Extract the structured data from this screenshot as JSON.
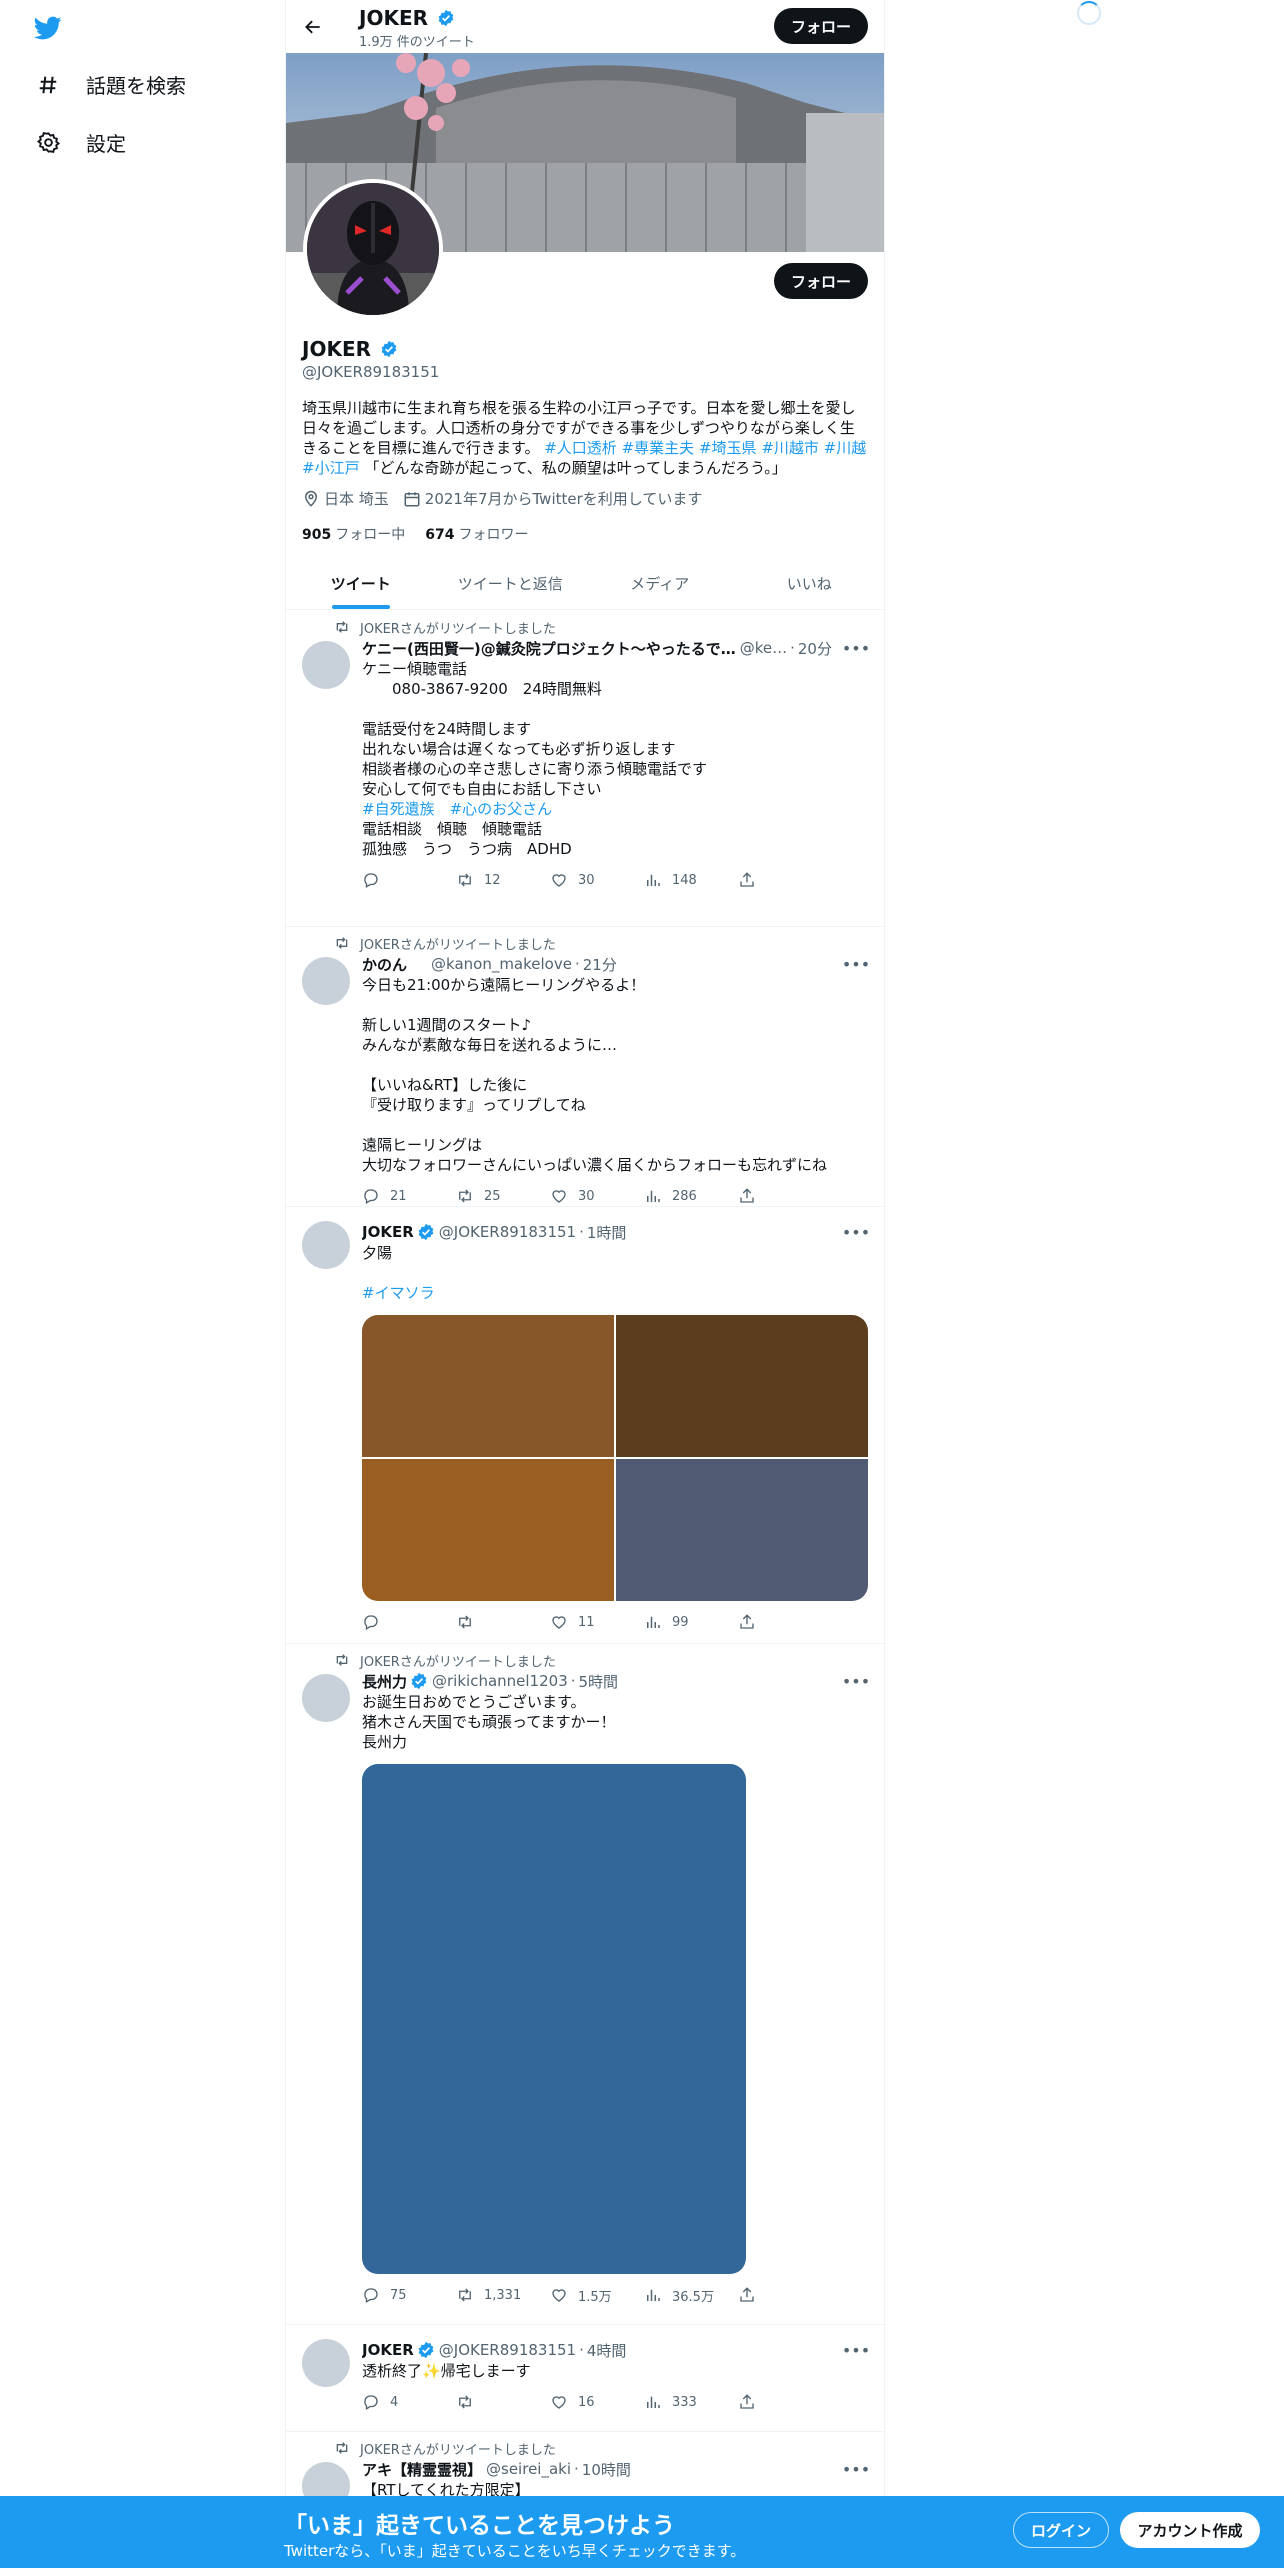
{
  "colors": {
    "accent": "#1d9bf0",
    "dark": "#0f1419",
    "muted": "#536471"
  },
  "sidebar": {
    "items": [
      {
        "icon": "hashtag-icon",
        "label": "話題を検索"
      },
      {
        "icon": "gear-icon",
        "label": "設定"
      }
    ]
  },
  "header": {
    "name": "JOKER",
    "tweet_count": "1.9万 件のツイート",
    "follow_label": "フォロー"
  },
  "profile": {
    "name": "JOKER",
    "handle": "@JOKER89183151",
    "follow_label": "フォロー",
    "bio_text": "埼玉県川越市に生まれ育ち根を張る生粋の小江戸っ子です。日本を愛し郷土を愛し日々を過ごします。人口透析の身分ですができる事を少しずつやりながら楽しく生きることを目標に進んで行きます。",
    "bio_tags": [
      "#人口透析",
      "#専業主夫",
      "#埼玉県",
      "#川越市",
      "#川越",
      "#小江戸"
    ],
    "bio_tail": "「どんな奇跡が起こって、私の願望は叶ってしまうんだろう。」",
    "location": "日本 埼玉",
    "joined": "2021年7月からTwitterを利用しています",
    "following_count": "905",
    "following_label": "フォロー中",
    "followers_count": "674",
    "followers_label": "フォロワー"
  },
  "tabs": [
    {
      "label": "ツイート",
      "active": true
    },
    {
      "label": "ツイートと返信",
      "active": false
    },
    {
      "label": "メディア",
      "active": false
    },
    {
      "label": "いいね",
      "active": false
    }
  ],
  "tweets": [
    {
      "retweeted_by": "JOKERさんがリツイートしました",
      "name": "ケニー(西田賢一)@鍼灸院プロジェクト～やったるで…",
      "handle": "@ke…",
      "time": "20分",
      "body": "ケニー傾聴電話\n　　080-3867-9200　24時間無料\n\n電話受付を24時間します\n出れない場合は遅くなっても必ず折り返します\n相談者様の心の辛さ悲しさに寄り添う傾聴電話です\n安心して何でも自由にお話し下さい\n",
      "tags": "#自死遺族　#心のお父さん",
      "body2": "電話相談　傾聴　傾聴電話\n孤独感　うつ　うつ病　ADHD",
      "replies": "",
      "retweets": "12",
      "likes": "30",
      "views": "148"
    },
    {
      "retweeted_by": "JOKERさんがリツイートしました",
      "name": "かのん",
      "handle": "@kanon_makelove",
      "time": "21分",
      "body": "今日も21:00から遠隔ヒーリングやるよ！\n\n新しい1週間のスタート♪\nみんなが素敵な毎日を送れるように…\n\n【いいね&RT】した後に\n『受け取ります』ってリプしてね\n\n遠隔ヒーリングは\n大切なフォロワーさんにいっぱい濃く届くからフォローも忘れずにね",
      "replies": "21",
      "retweets": "25",
      "likes": "30",
      "views": "286"
    },
    {
      "name": "JOKER",
      "handle": "@JOKER89183151",
      "time": "1時間",
      "body": "夕陽\n",
      "tags": "#イマソラ",
      "media_colors": [
        "#87572a",
        "#5c3d1e",
        "#9a5e22",
        "#505a72"
      ],
      "replies": "",
      "retweets": "",
      "likes": "11",
      "views": "99"
    },
    {
      "retweeted_by": "JOKERさんがリツイートしました",
      "name": "長州力",
      "handle": "@rikichannel1203",
      "time": "5時間",
      "body": "お誕生日おめでとうございます。\n猪木さん天国でも頑張ってますかー！\n長州力",
      "media_color": "#336699",
      "replies": "75",
      "retweets": "1,331",
      "likes": "1.5万",
      "views": "36.5万"
    },
    {
      "name": "JOKER",
      "handle": "@JOKER89183151",
      "time": "4時間",
      "body": "透析終了✨帰宅しまーす",
      "replies": "4",
      "retweets": "",
      "likes": "16",
      "views": "333"
    },
    {
      "retweeted_by": "JOKERさんがリツイートしました",
      "name": "アキ【精霊霊視】",
      "handle": "@seirei_aki",
      "time": "10時間",
      "body": "【RTしてくれた方限定】"
    }
  ],
  "bottombar": {
    "title": "「いま」起きていることを見つけよう",
    "subtitle": "Twitterなら、「いま」起きていることをいち早くチェックできます。",
    "login": "ログイン",
    "signup": "アカウント作成"
  }
}
